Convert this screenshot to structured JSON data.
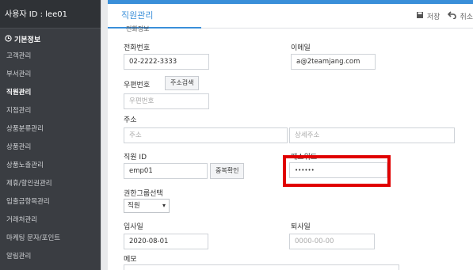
{
  "sidebar": {
    "user_label": "사용자 ID : lee01",
    "section_title": "기본정보",
    "items": [
      {
        "label": "고객관리",
        "active": false
      },
      {
        "label": "부서관리",
        "active": false
      },
      {
        "label": "직원관리",
        "active": true
      },
      {
        "label": "지점관리",
        "active": false
      },
      {
        "label": "상품분류관리",
        "active": false
      },
      {
        "label": "상품관리",
        "active": false
      },
      {
        "label": "상품노출관리",
        "active": false
      },
      {
        "label": "제휴/할인권관리",
        "active": false
      },
      {
        "label": "입출금항목관리",
        "active": false
      },
      {
        "label": "거래처관리",
        "active": false
      },
      {
        "label": "마케팅 문자/포인트",
        "active": false
      },
      {
        "label": "알림관리",
        "active": false
      }
    ]
  },
  "header": {
    "title": "직원관리",
    "save_label": "저장",
    "cancel_label": "취소"
  },
  "form": {
    "cut_label": "전화정보",
    "phone_label": "전화번호",
    "phone_value": "02-2222-3333",
    "email_label": "이메일",
    "email_value": "a@2teamjang.com",
    "zip_label": "우편번호",
    "zip_button": "주소검색",
    "zip_placeholder": "우편번호",
    "address_label": "주소",
    "address_placeholder": "주소",
    "address_detail_placeholder": "상세주소",
    "staff_id_label": "직원 ID",
    "staff_id_value": "emp01",
    "dup_check_button": "중복확인",
    "password_label": "패스워드",
    "password_value": "••••••",
    "group_label": "권한그룹선택",
    "group_value": "직원",
    "join_label": "입사일",
    "join_value": "2020-08-01",
    "leave_label": "퇴사일",
    "leave_placeholder": "0000-00-00",
    "memo_label": "메모"
  },
  "colors": {
    "accent": "#3a8fd9",
    "highlight": "#e00000",
    "sidebar": "#3a3d42"
  }
}
